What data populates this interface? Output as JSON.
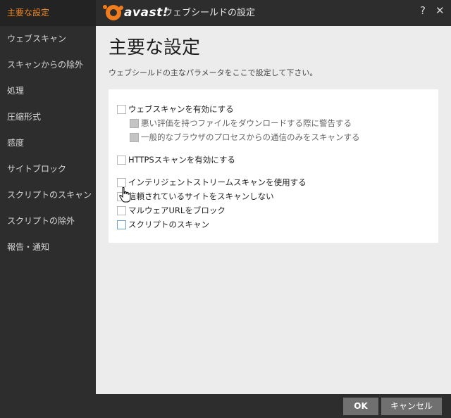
{
  "sidebar": {
    "items": [
      {
        "label": "主要な設定"
      },
      {
        "label": "ウェブスキャン"
      },
      {
        "label": "スキャンからの除外"
      },
      {
        "label": "処理"
      },
      {
        "label": "圧縮形式"
      },
      {
        "label": "感度"
      },
      {
        "label": "サイトブロック"
      },
      {
        "label": "スクリプトのスキャン"
      },
      {
        "label": "スクリプトの除外"
      },
      {
        "label": "報告・通知"
      }
    ],
    "active_index": 0
  },
  "titlebar": {
    "logo_text": "avast!",
    "title": "ウェブシールドの設定",
    "help": "?",
    "close": "✕"
  },
  "main": {
    "title": "主要な設定",
    "description": "ウェブシールドの主なパラメータをここで設定して下さい。",
    "options": [
      {
        "label": "ウェブスキャンを有効にする",
        "checked": false
      },
      {
        "label": "悪い評価を持つファイルをダウンロードする際に警告する",
        "checked": false,
        "disabled": true
      },
      {
        "label": "一般的なブラウザのプロセスからの通信のみをスキャンする",
        "checked": false,
        "disabled": true
      },
      {
        "label": "HTTPSスキャンを有効にする",
        "checked": false
      },
      {
        "label": "インテリジェントストリームスキャンを使用する",
        "checked": false
      },
      {
        "label": "信頼されているサイトをスキャンしない",
        "checked": false
      },
      {
        "label": "マルウェアURLをブロック",
        "checked": false
      },
      {
        "label": "スクリプトのスキャン",
        "checked": false
      }
    ]
  },
  "footer": {
    "ok_label": "OK",
    "cancel_label": "キャンセル"
  },
  "colors": {
    "accent": "#f08a24",
    "sidebar_bg": "#2d2d2d",
    "content_bg": "#ececec",
    "button_bg": "#707070"
  }
}
